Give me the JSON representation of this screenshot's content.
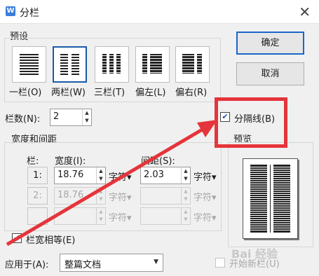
{
  "window": {
    "title": "分栏",
    "icon": "W"
  },
  "presets": {
    "label": "预设",
    "items": [
      {
        "label": "一栏(O)"
      },
      {
        "label": "两栏(W)"
      },
      {
        "label": "三栏(T)"
      },
      {
        "label": "偏左(L)"
      },
      {
        "label": "偏右(R)"
      }
    ]
  },
  "buttons": {
    "ok": "确定",
    "cancel": "取消"
  },
  "columns_count": {
    "label": "栏数(N):",
    "value": "2"
  },
  "width_spacing": {
    "label": "宽度和间距",
    "header_col": "栏:",
    "header_width": "宽度(I):",
    "header_spacing": "间距(S):",
    "rows": [
      {
        "col": "1:",
        "width": "18.76",
        "width_unit": "字符",
        "spacing": "2.03",
        "spacing_unit": "字符"
      },
      {
        "col": "2:",
        "width": "18.76",
        "width_unit": "字符",
        "spacing": "",
        "spacing_unit": "字符"
      },
      {
        "col": "",
        "width": "",
        "width_unit": "字符",
        "spacing": "",
        "spacing_unit": "字符"
      }
    ]
  },
  "equal_width": {
    "label": "栏宽相等(E)",
    "checked": true
  },
  "divider": {
    "label": "分隔线(B)",
    "checked": true
  },
  "preview": {
    "label": "预览"
  },
  "apply_to": {
    "label": "应用于(A):",
    "value": "整篇文档"
  },
  "new_column": {
    "label": "开始新栏(U)",
    "checked": false
  },
  "watermark": "Bai 经验",
  "colors": {
    "annotation": "#e5343b",
    "accent": "#1a5aa8"
  }
}
